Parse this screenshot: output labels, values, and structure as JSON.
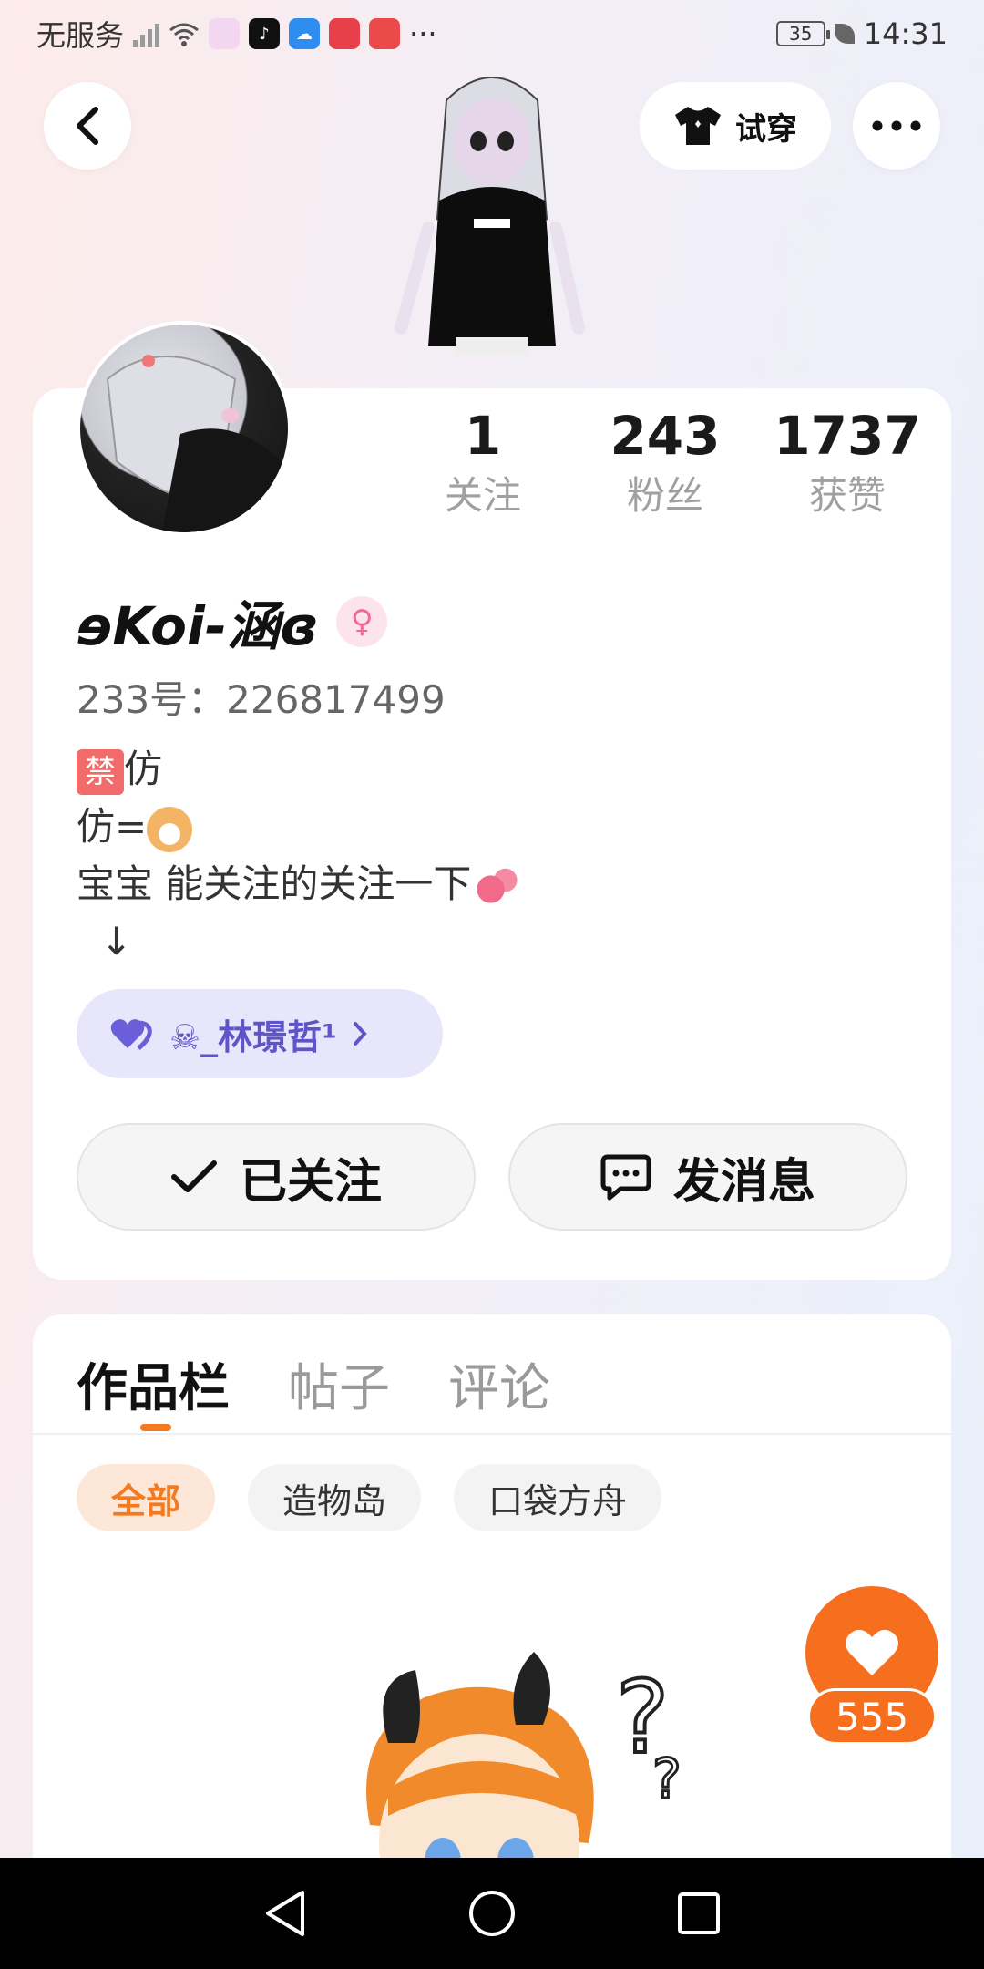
{
  "status_bar": {
    "carrier": "无服务",
    "more": "···",
    "battery": "35",
    "time": "14:31",
    "app_icons": [
      "xiaohongshu-icon",
      "tiktok-icon",
      "weather-icon",
      "huawei-store-icon",
      "reader-icon"
    ]
  },
  "header": {
    "back_icon": "chevron-left-icon",
    "try_on_label": "试穿",
    "more_icon": "ellipsis-icon"
  },
  "profile": {
    "stats": [
      {
        "value": "1",
        "label": "关注"
      },
      {
        "value": "243",
        "label": "粉丝"
      },
      {
        "value": "1737",
        "label": "获赞"
      }
    ],
    "nickname": "ɘKoi-涵ɞ",
    "gender": "♀",
    "uid": "233号：226817499",
    "bio": {
      "line1_badge": "禁",
      "line1_text": "仿",
      "line2_text": "仿=",
      "line3_text": "宝宝  能关注的关注一下",
      "line4_text": "↓"
    },
    "relation": {
      "label": "☠_林璟哲¹",
      "accent": "#5f55c8"
    },
    "follow_button": "已关注",
    "message_button": "发消息"
  },
  "works": {
    "tabs": [
      "作品栏",
      "帖子",
      "评论"
    ],
    "active_tab": "作品栏",
    "filters": [
      "全部",
      "造物岛",
      "口袋方舟"
    ],
    "active_filter": "全部"
  },
  "like_fab": {
    "count": "555",
    "color": "#f66f1f"
  },
  "colors": {
    "accent": "#f47a1f"
  }
}
